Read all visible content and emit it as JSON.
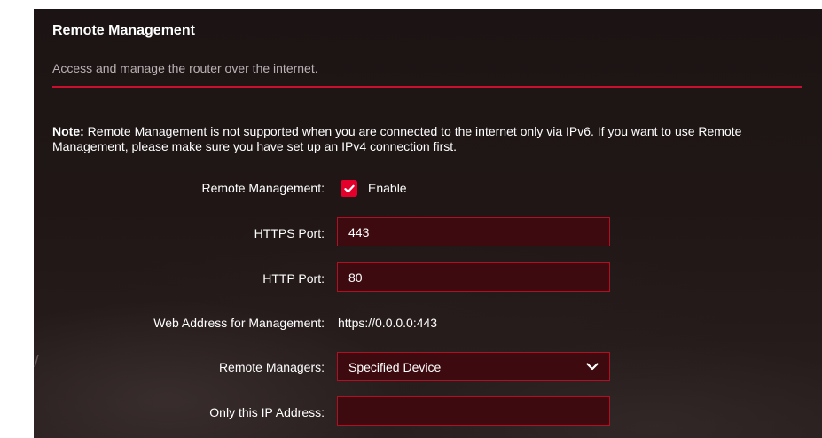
{
  "panel": {
    "title": "Remote Management",
    "subtitle": "Access and manage the router over the internet."
  },
  "note": {
    "label": "Note:",
    "text": " Remote Management is not supported when you are connected to the internet only via IPv6. If you want to use Remote Management, please make sure you have set up an IPv4 connection first."
  },
  "form": {
    "remote_management": {
      "label": "Remote Management:",
      "checkbox_checked": true,
      "checkbox_label": "Enable"
    },
    "https_port": {
      "label": "HTTPS Port:",
      "value": "443"
    },
    "http_port": {
      "label": "HTTP Port:",
      "value": "80"
    },
    "web_address": {
      "label": "Web Address for Management:",
      "value": "https://0.0.0.0:443"
    },
    "remote_managers": {
      "label": "Remote Managers:",
      "selected": "Specified Device"
    },
    "only_ip": {
      "label": "Only this IP Address:",
      "value": ""
    }
  },
  "colors": {
    "accent": "#e4002b",
    "background": "#1e1616",
    "field_bg": "#3d0a0f",
    "field_border": "#b21022",
    "subtitle_text": "#b9b2b2"
  },
  "icons": {
    "checkbox": "check-icon",
    "dropdown": "chevron-down-icon"
  }
}
